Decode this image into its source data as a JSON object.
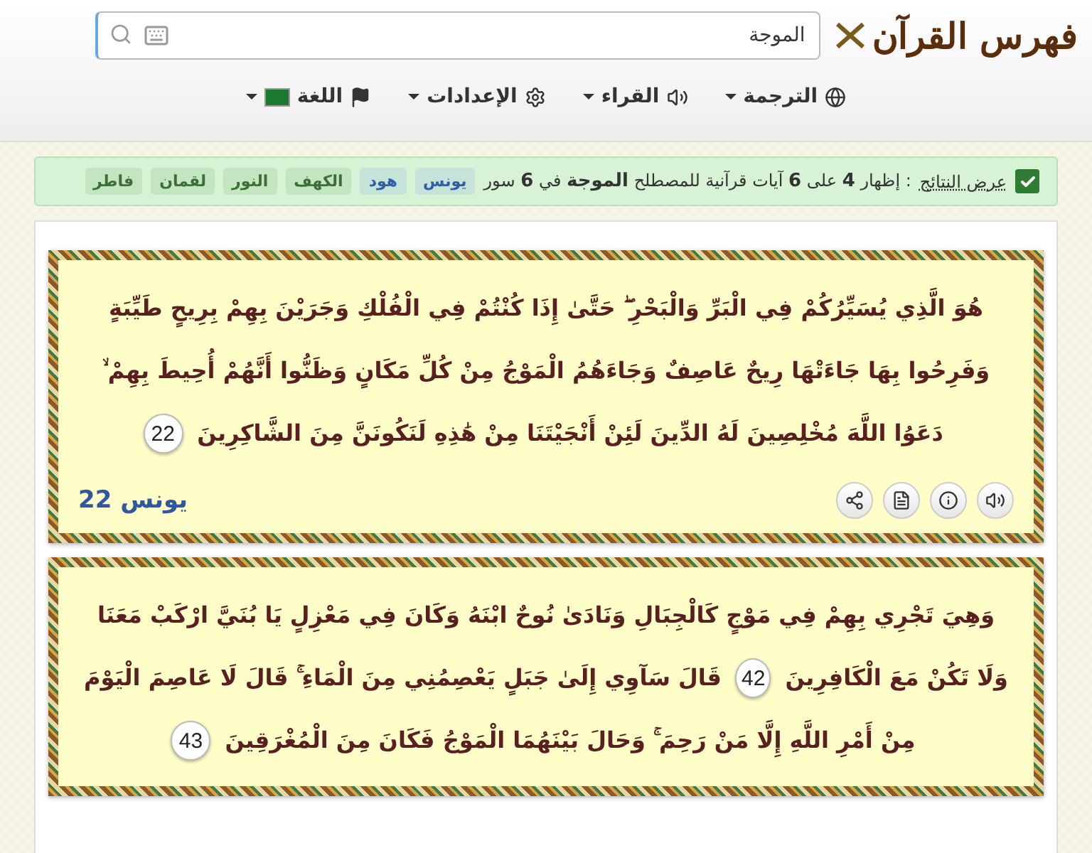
{
  "header": {
    "logo": "فهرس القرآن",
    "search": {
      "value": "الموجة"
    },
    "nav": [
      {
        "label": "الترجمة",
        "kind": "translation"
      },
      {
        "label": "القراء",
        "kind": "reciters"
      },
      {
        "label": "الإعدادات",
        "kind": "settings"
      },
      {
        "label": "اللغة",
        "kind": "language"
      }
    ]
  },
  "results": {
    "checked": true,
    "link": "عرض النتائج",
    "summary": ": إظهار **4** على **6** آيات قرآنية للمصطلح **الموجة** في **6** سور",
    "surahs": [
      {
        "label": "يونس",
        "selected": true
      },
      {
        "label": "هود",
        "selected": true
      },
      {
        "label": "الكهف",
        "selected": false
      },
      {
        "label": "النور",
        "selected": false
      },
      {
        "label": "لقمان",
        "selected": false
      },
      {
        "label": "فاطر",
        "selected": false
      }
    ]
  },
  "verses": [
    {
      "reference": "يونس 22",
      "lines": [
        [
          {
            "kind": "text",
            "text": "هُوَ الَّذِي يُسَيِّرُكُمْ فِي الْبَرِّ وَالْبَحْرِ ۖ حَتَّىٰ إِذَا كُنْتُمْ فِي الْفُلْكِ وَجَرَيْنَ بِهِمْ بِرِيحٍ طَيِّبَةٍ"
          }
        ],
        [
          {
            "kind": "text",
            "text": "وَفَرِحُوا بِهَا جَاءَتْهَا رِيحٌ عَاصِفٌ وَجَاءَهُمُ الْمَوْجُ مِنْ كُلِّ مَكَانٍ وَظَنُّوا أَنَّهُمْ أُحِيطَ بِهِمْ ۙ"
          }
        ],
        [
          {
            "kind": "text",
            "text": "دَعَوُا اللَّهَ مُخْلِصِينَ لَهُ الدِّينَ لَئِنْ أَنْجَيْتَنَا مِنْ هَٰذِهِ لَنَكُونَنَّ مِنَ الشَّاكِرِينَ"
          },
          {
            "kind": "number",
            "text": "22"
          }
        ]
      ]
    },
    {
      "lines": [
        [
          {
            "kind": "text",
            "text": "وَهِيَ تَجْرِي بِهِمْ فِي مَوْجٍ كَالْجِبَالِ وَنَادَىٰ نُوحٌ ابْنَهُ وَكَانَ فِي مَعْزِلٍ يَا بُنَيَّ ارْكَبْ مَعَنَا"
          }
        ],
        [
          {
            "kind": "text",
            "text": "وَلَا تَكُنْ مَعَ الْكَافِرِينَ"
          },
          {
            "kind": "number",
            "text": "42"
          },
          {
            "kind": "text",
            "text": "قَالَ سَآوِي إِلَىٰ جَبَلٍ يَعْصِمُنِي مِنَ الْمَاءِ ۚ قَالَ لَا عَاصِمَ الْيَوْمَ"
          }
        ],
        [
          {
            "kind": "text",
            "text": "مِنْ أَمْرِ اللَّهِ إِلَّا مَنْ رَحِمَ ۚ وَحَالَ بَيْنَهُمَا الْمَوْجُ فَكَانَ مِنَ الْمُغْرَقِينَ"
          },
          {
            "kind": "number",
            "text": "43"
          }
        ]
      ]
    }
  ]
}
